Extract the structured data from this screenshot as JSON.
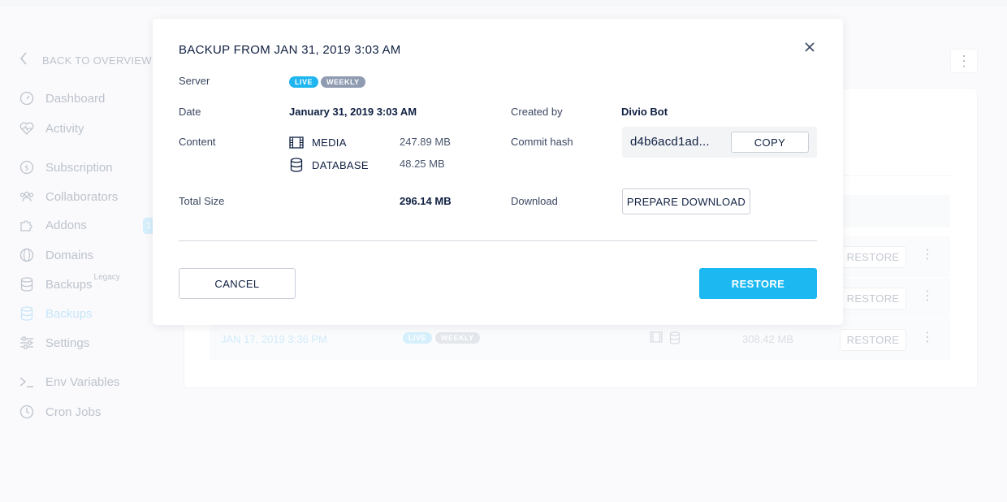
{
  "sidebar": {
    "back_label": "BACK TO OVERVIEW",
    "items": [
      {
        "label": "Dashboard",
        "icon": "gauge-icon"
      },
      {
        "label": "Activity",
        "icon": "heartbeat-icon"
      },
      {
        "label": "Subscription",
        "icon": "dollar-icon"
      },
      {
        "label": "Collaborators",
        "icon": "users-icon"
      },
      {
        "label": "Addons",
        "icon": "puzzle-icon"
      },
      {
        "label": "Domains",
        "icon": "globe-icon"
      },
      {
        "label": "Backups",
        "sup": "Legacy",
        "icon": "database-icon"
      },
      {
        "label": "Backups",
        "icon": "database-icon"
      },
      {
        "label": "Settings",
        "icon": "sliders-icon"
      },
      {
        "label": "Env Variables",
        "icon": "terminal-icon"
      },
      {
        "label": "Cron Jobs",
        "icon": "clock-icon"
      }
    ],
    "addons_badge": "1"
  },
  "background_rows": [
    {
      "date": "",
      "restore": "RESTORE"
    },
    {
      "date": "",
      "restore": "RESTORE"
    },
    {
      "date": "JAN 17, 2019 3:36 PM",
      "tag_live": "LIVE",
      "tag_weekly": "WEEKLY",
      "size": "308.42 MB",
      "restore": "RESTORE"
    }
  ],
  "modal": {
    "title": "BACKUP FROM JAN 31, 2019 3:03 AM",
    "server_label": "Server",
    "server_tags": [
      "LIVE",
      "WEEKLY"
    ],
    "date_label": "Date",
    "date_value": "January 31, 2019 3:03 AM",
    "created_by_label": "Created by",
    "created_by_value": "Divio Bot",
    "content_label": "Content",
    "content": [
      {
        "name": "MEDIA",
        "size": "247.89 MB",
        "icon": "film-icon"
      },
      {
        "name": "DATABASE",
        "size": "48.25 MB",
        "icon": "database-icon"
      }
    ],
    "commit_hash_label": "Commit hash",
    "commit_hash_value": "d4b6acd1ad...",
    "copy_label": "COPY",
    "total_size_label": "Total Size",
    "total_size_value": "296.14 MB",
    "download_label": "Download",
    "prepare_download_label": "PREPARE DOWNLOAD",
    "cancel_label": "CANCEL",
    "restore_label": "RESTORE"
  },
  "colors": {
    "accent": "#1cb8f2",
    "tag_live": "#1fb6f0",
    "tag_weekly": "#8f9bb0",
    "text_dark": "#102042"
  }
}
